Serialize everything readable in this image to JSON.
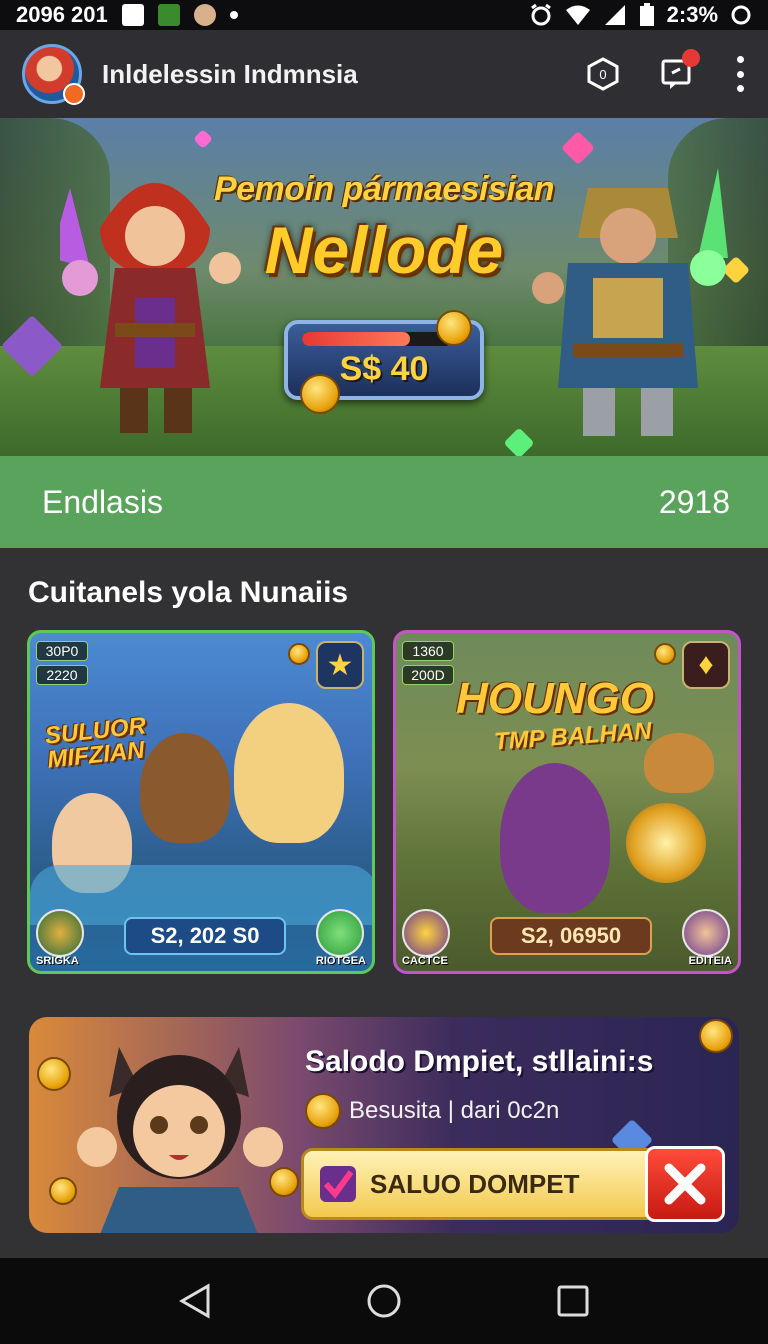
{
  "status_bar": {
    "time_left": "2096 201",
    "time_right": "2:3% ",
    "icons": [
      "app-icon-a",
      "app-icon-b",
      "face-icon",
      "dot-icon",
      "alarm-icon",
      "wifi-icon",
      "signal-icon",
      "battery-icon",
      "sync-icon"
    ]
  },
  "app_bar": {
    "title": "Inldelessin Indmnsia",
    "hex_badge": "0"
  },
  "hero": {
    "subtitle": "Pemoin pármaesisian",
    "title": "Nellode",
    "prize": "S$ 40",
    "progress": 0.72
  },
  "stats": {
    "label": "Endlasis",
    "value": "2918"
  },
  "section": {
    "title": "Cuitanels yola Nunaiis"
  },
  "cards": [
    {
      "tag_top": "30P0",
      "tag_bottom": "2220",
      "logo": "SULUOR MIFZIAN",
      "price": "S2, 202 S0",
      "left_label": "SRIGKA",
      "right_label": "RIOTGEA",
      "accent": "#5cc95a"
    },
    {
      "tag_top": "1360",
      "tag_bottom": "200D",
      "logo": "HOUNGO",
      "logo_sub": "TMP BALHAN",
      "price": "S2, 06950",
      "left_label": "CACTCE",
      "right_label": "EDITEIA",
      "accent": "#c455c9"
    }
  ],
  "promo": {
    "title": "Salodo Dmpiet, stllaini:s",
    "subtitle": "Besusita | dari 0c2n",
    "button": "SALUO DOMPET"
  },
  "colors": {
    "green_bar": "#5aa35c",
    "card1_border": "#5cc95a",
    "card2_border": "#c455c9",
    "close_red": "#e53935"
  }
}
